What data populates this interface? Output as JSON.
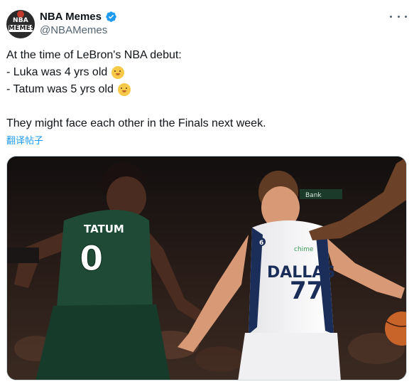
{
  "author": {
    "display_name": "NBA Memes",
    "handle": "@NBAMemes",
    "avatar_text_top": "NBA",
    "avatar_text_bottom": "MEMES",
    "verified_icon": "verified-badge-icon"
  },
  "tweet": {
    "lines": [
      "At the time of LeBron's NBA debut:",
      "- Luka was 4 yrs old",
      "- Tatum was 5 yrs old",
      "",
      "They might face each other in the Finals next week."
    ],
    "emoji": "baby-face-emoji",
    "translate_label": "翻译帖子"
  },
  "photo": {
    "jersey_left_name": "TATUM",
    "jersey_left_number": "0",
    "jersey_right_team": "DALLAS",
    "jersey_right_number": "77",
    "jersey_right_patch": "6",
    "jersey_right_sponsor": "chime",
    "scoreboard_text": "Bank"
  },
  "colors": {
    "accent": "#1d9bf0",
    "text": "#0f1419",
    "secondary": "#536471",
    "celtics_green": "#1e4a36",
    "mavs_navy": "#1b2e5a"
  }
}
